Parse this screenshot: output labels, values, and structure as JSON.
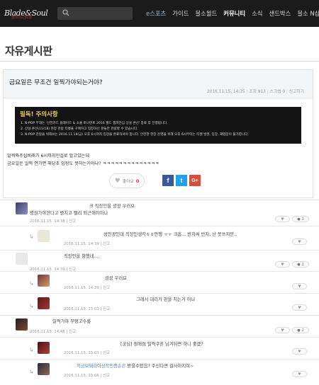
{
  "brand": {
    "logo": "Blade&Soul",
    "logo_sub": "블레이드앤소울"
  },
  "nav": {
    "items": [
      "e스포츠",
      "가이드",
      "블소월드",
      "커뮤니티",
      "소식",
      "샌드박스",
      "블소 N샵"
    ],
    "active": "커뮤니티"
  },
  "page": {
    "title": "자유게시판"
  },
  "post": {
    "title": "금요일은 무조건 일찍가야되는거야?",
    "date": "2016.11.15. 14:35",
    "views": "조회 913",
    "scrap": "스크랩 0",
    "report": "신고하기",
    "notice_title": "필독! 주의사항",
    "notice_lines": [
      "1. N-POP 무대는 '신한카드 블레이드 & 소울 토너먼트 2016 월드 챔피언십 상설 콘선' 종료 후 진행됩니다.",
      "2. 상설 콘선(11/18) 현장 관람 티켓을 구매하고 입장하신 분들만 관람할 수 있습니다.",
      "3. N-POP 관람을 위해서는 2016.11.18(금) 오후 6시까지 입장을 완료하셔야 합니다. 안전한 현장 운영을 위해 오후 6시부터는 티켓 발권, 입장, 재입장이 불가합니다."
    ],
    "body": [
      "일찍와주십비래가 6시까지인걸로 알고있는데",
      "금요일은 일찍 안가면 해당초 입장도 못하는거아냐? ㅋㅋㅋㅋㅋㅋㅋㅋㅋㅋㅋㅋㅋㅋ"
    ],
    "like_label": "좋아요",
    "like_count": "0",
    "share": {
      "facebook": "f",
      "twitter": "t",
      "google": "G+"
    }
  },
  "comments": [
    {
      "lines": [
        "크 직장인을 광광 우러요",
        "병원가야한다고 병치고 빨리 퇴근해야하나"
      ],
      "date": "2016.11.15. 14:38",
      "report": "신고",
      "votes": "1"
    },
    {
      "reply": true,
      "text": "성인광인데 직장인생각ㅎㅎ만행 ㅜㅜ 크흠... 반차써 반차, 난 못쓰지만..",
      "date": "2016.11.15. 14:39",
      "report": "신고"
    },
    {
      "text": "직장인을 향했네....",
      "date": "2016.11.15. 14:39",
      "report": "신고",
      "votes": "2"
    },
    {
      "reply": true,
      "text": "광광 우러요",
      "date": "2016.11.15. 14:39",
      "report": "신고"
    },
    {
      "reply": true,
      "text": "그래서 대리가 판을 치는거 아냐",
      "date": "2016.11.15. 15:03",
      "report": "신고"
    },
    {
      "text": "일찍가야 무엉고수룡",
      "date": "2016.11.15. 14:48",
      "report": "신고",
      "votes": "2"
    },
    {
      "reply": true,
      "text": "[궁님] 점매점 일찍쿠폰 남겨뒤면 하니 좋겠?",
      "date": "2016.11.15. 15:03",
      "report": "신고"
    },
    {
      "reply": true,
      "text_prefix": "지금보돼라이상작인증손은 ",
      "text": "받을수있음? 주신다면 감사하지여~",
      "date": "2016.11.15. 15:06",
      "report": "신고"
    }
  ],
  "colors": {
    "topbar": "#1b1b1b",
    "notice_title": "#e8cc5c",
    "like_count": "#e0383e",
    "facebook": "#3b5998",
    "twitter": "#1da1f2",
    "google": "#dd4b39",
    "reply_highlight": "#4a7bb7"
  },
  "icons": {
    "search": "search-icon",
    "heart": "heart-icon",
    "reply": "reply-arrow-icon",
    "like": "heart-icon"
  }
}
